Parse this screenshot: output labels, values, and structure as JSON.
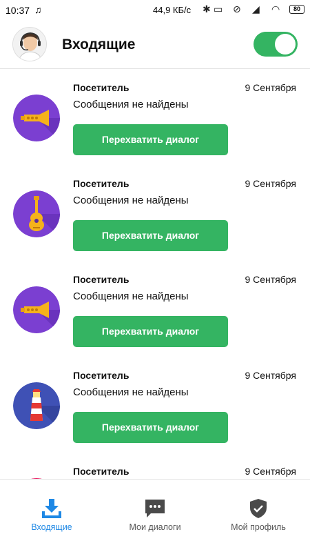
{
  "status_bar": {
    "time": "10:37",
    "network_speed": "44,9 КБ/с",
    "battery": "80"
  },
  "header": {
    "title": "Входящие",
    "toggle_on": true
  },
  "items": [
    {
      "icon": "trumpet-icon",
      "name": "Посетитель",
      "date": "9 Сентября",
      "message": "Сообщения не найдены",
      "button": "Перехватить диалог"
    },
    {
      "icon": "guitar-icon",
      "name": "Посетитель",
      "date": "9 Сентября",
      "message": "Сообщения не найдены",
      "button": "Перехватить диалог"
    },
    {
      "icon": "trumpet-icon",
      "name": "Посетитель",
      "date": "9 Сентября",
      "message": "Сообщения не найдены",
      "button": "Перехватить диалог"
    },
    {
      "icon": "lighthouse-icon",
      "name": "Посетитель",
      "date": "9 Сентября",
      "message": "Сообщения не найдены",
      "button": "Перехватить диалог"
    },
    {
      "icon": "pink-avatar-icon",
      "name": "Посетитель",
      "date": "9 Сентября",
      "message": "",
      "button": ""
    }
  ],
  "bottom_nav": [
    {
      "label": "Входящие",
      "icon": "inbox-download-icon",
      "active": true
    },
    {
      "label": "Мои диалоги",
      "icon": "chat-bubble-icon",
      "active": false
    },
    {
      "label": "Мой профиль",
      "icon": "shield-check-icon",
      "active": false
    }
  ],
  "colors": {
    "accent_green": "#34b462",
    "active_blue": "#1e88e5",
    "icon_purple": "#7b3fd1",
    "icon_blue": "#3f51b5"
  }
}
